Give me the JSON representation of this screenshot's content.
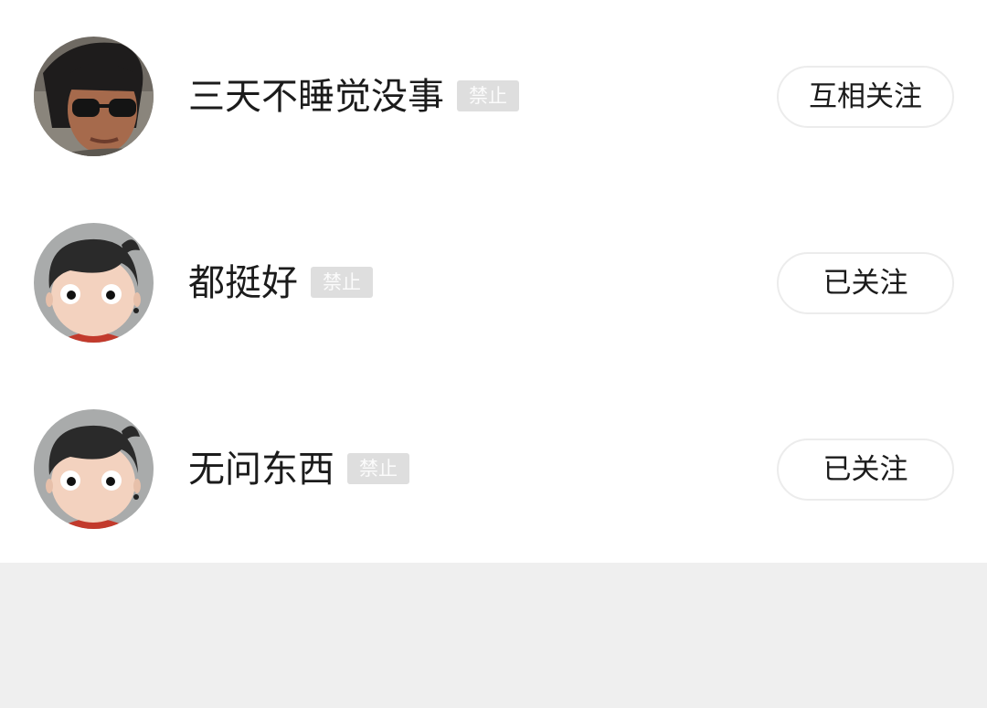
{
  "users": [
    {
      "name": "三天不睡觉没事",
      "badge": "禁止",
      "follow_label": "互相关注",
      "avatar": "photo-avatar-sunglasses"
    },
    {
      "name": "都挺好",
      "badge": "禁止",
      "follow_label": "已关注",
      "avatar": "cartoon-avatar-default"
    },
    {
      "name": "无问东西",
      "badge": "禁止",
      "follow_label": "已关注",
      "avatar": "cartoon-avatar-default"
    }
  ],
  "colors": {
    "page_background": "#efefef",
    "list_background": "#ffffff",
    "badge_background": "#dedede",
    "button_border": "#ececec"
  }
}
